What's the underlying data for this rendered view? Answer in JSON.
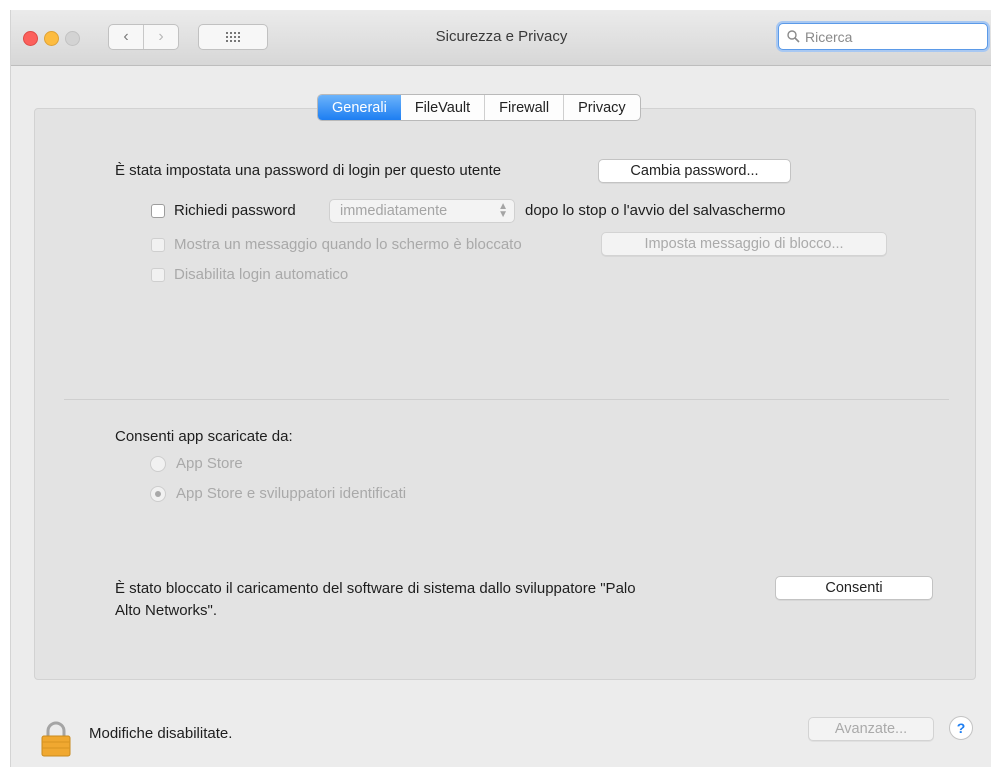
{
  "window": {
    "title": "Sicurezza e Privacy",
    "search_placeholder": "Ricerca",
    "nav_back": "‹",
    "nav_forward": "›"
  },
  "tabs": [
    {
      "label": "Generali",
      "active": true
    },
    {
      "label": "FileVault",
      "active": false
    },
    {
      "label": "Firewall",
      "active": false
    },
    {
      "label": "Privacy",
      "active": false
    }
  ],
  "general": {
    "password_set_text": "È stata impostata una password di login per questo utente",
    "change_password_button": "Cambia password...",
    "require_password_label": "Richiedi password",
    "require_password_value": "immediatamente",
    "require_password_suffix": "dopo lo stop o l'avvio del salvaschermo",
    "show_message_label": "Mostra un messaggio quando lo schermo è bloccato",
    "set_lock_message_button": "Imposta messaggio di blocco...",
    "disable_auto_login_label": "Disabilita login automatico"
  },
  "downloads": {
    "heading": "Consenti app scaricate da:",
    "options": [
      {
        "label": "App Store",
        "selected": false
      },
      {
        "label": "App Store e sviluppatori identificati",
        "selected": true
      }
    ]
  },
  "blocked": {
    "text_line1": "È stato bloccato il caricamento del software di sistema dallo sviluppatore \"Palo",
    "text_line2": "Alto Networks\".",
    "allow_button": "Consenti"
  },
  "footer": {
    "lock_text": "Modifiche disabilitate.",
    "advanced_button": "Avanzate...",
    "help_label": "?"
  },
  "icons": {
    "lock": "lock-icon",
    "search": "search-icon",
    "grid": "grid-icon"
  },
  "colors": {
    "accent": "#1d7ef2",
    "lock": "#f0a830"
  }
}
